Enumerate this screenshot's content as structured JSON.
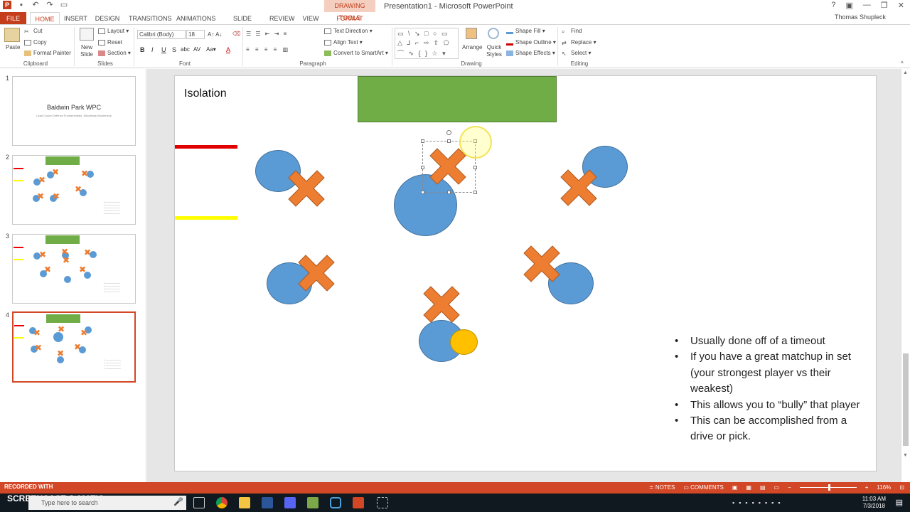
{
  "titlebar": {
    "doc_title": "Presentation1 - Microsoft PowerPoint",
    "drawing_tools": "DRAWING TOOLS",
    "user": "Thomas Shupleck"
  },
  "tabs": [
    "FILE",
    "HOME",
    "INSERT",
    "DESIGN",
    "TRANSITIONS",
    "ANIMATIONS",
    "SLIDE SHOW",
    "REVIEW",
    "VIEW",
    "FORMAT"
  ],
  "ribbon": {
    "clipboard": {
      "paste": "Paste",
      "cut": "Cut",
      "copy": "Copy",
      "format_painter": "Format Painter",
      "label": "Clipboard"
    },
    "slides": {
      "new_slide": "New Slide",
      "layout": "Layout",
      "reset": "Reset",
      "section": "Section",
      "label": "Slides"
    },
    "font": {
      "family": "Calibri (Body)",
      "size": "18",
      "label": "Font"
    },
    "paragraph": {
      "text_direction": "Text Direction",
      "align_text": "Align Text",
      "convert": "Convert to SmartArt",
      "label": "Paragraph"
    },
    "drawing": {
      "arrange": "Arrange",
      "quick_styles": "Quick Styles",
      "shape_fill": "Shape Fill",
      "shape_outline": "Shape Outline",
      "shape_effects": "Shape Effects",
      "label": "Drawing"
    },
    "editing": {
      "find": "Find",
      "replace": "Replace",
      "select": "Select",
      "label": "Editing"
    }
  },
  "thumbnails": {
    "slide1_title": "Baldwin Park WPC",
    "slide1_sub": "Lead Coach Defense Fundamentals: Situational Awareness"
  },
  "slide": {
    "title": "Isolation",
    "bullets": [
      "Usually done off of a timeout",
      "If you have a great matchup in set (your strongest player vs their weakest)",
      "This allows you to “bully” that player",
      "This can be accomplished from a drive or pick."
    ]
  },
  "colors": {
    "accent": "#d24726",
    "circle": "#5b9bd5",
    "x": "#ed7d31",
    "green": "#70ad47",
    "ball": "#ffc000"
  },
  "statusbar": {
    "watermark": "RECORDED WITH",
    "notes": "NOTES",
    "comments": "COMMENTS",
    "zoom": "116%"
  },
  "taskbar": {
    "search_placeholder": "Type here to search",
    "time": "11:03 AM",
    "date": "7/3/2018",
    "screencast": "SCREENCAST-O-MATIC"
  }
}
